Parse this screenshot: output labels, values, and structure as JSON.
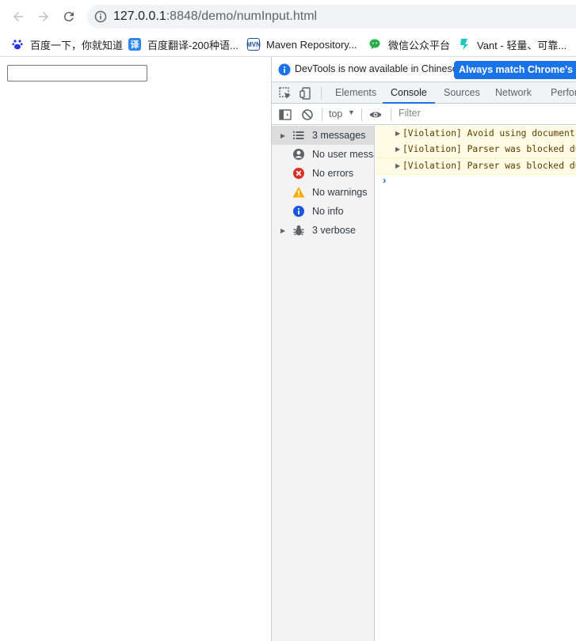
{
  "browser": {
    "url_host": "127.0.0.1",
    "url_path": ":8848/demo/numInput.html"
  },
  "bookmarks": [
    {
      "label": "百度一下，你就知道"
    },
    {
      "label": "百度翻译-200种语..."
    },
    {
      "label": "Maven Repository..."
    },
    {
      "label": "微信公众平台"
    },
    {
      "label": "Vant - 轻量、可靠..."
    }
  ],
  "page": {
    "input_value": ""
  },
  "devtools": {
    "infobar_message": "DevTools is now available in Chinese!",
    "infobar_button": "Always match Chrome's language",
    "tabs": [
      "Elements",
      "Console",
      "Sources",
      "Network",
      "Performance"
    ],
    "active_tab": "Console",
    "context": "top",
    "filter_placeholder": "Filter",
    "sidebar": [
      {
        "label": "3 messages",
        "icon": "list-icon"
      },
      {
        "label": "No user messages",
        "icon": "user-icon"
      },
      {
        "label": "No errors",
        "icon": "error-icon"
      },
      {
        "label": "No warnings",
        "icon": "warning-icon"
      },
      {
        "label": "No info",
        "icon": "info-icon"
      },
      {
        "label": "3 verbose",
        "icon": "bug-icon"
      }
    ],
    "messages": [
      {
        "text": "[Violation] Avoid using document.write()."
      },
      {
        "text": "[Violation] Parser was blocked due to document.write(<script>)"
      },
      {
        "text": "[Violation] Parser was blocked due to document.write(<script>)"
      }
    ],
    "colors": {
      "accent": "#1a73e8",
      "warning_bg": "#fffbe5",
      "error": "#d93025",
      "warning": "#f9ab00"
    }
  }
}
